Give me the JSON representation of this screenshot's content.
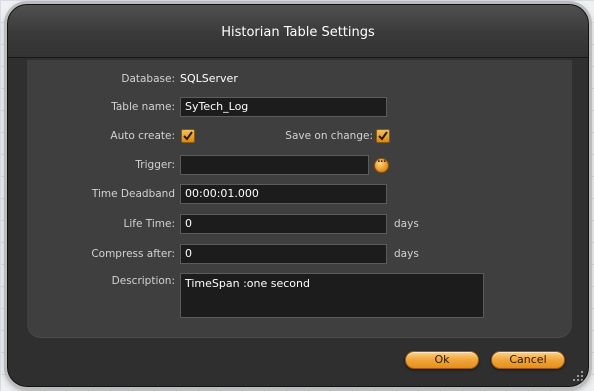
{
  "dialog": {
    "title": "Historian Table Settings",
    "database": {
      "label": "Database:",
      "value": "SQLServer"
    },
    "table_name": {
      "label": "Table name:",
      "value": "SyTech_Log"
    },
    "auto_create": {
      "label": "Auto create:",
      "checked": true
    },
    "save_on_change": {
      "label": "Save on change:",
      "checked": true
    },
    "trigger": {
      "label": "Trigger:",
      "value": "",
      "browse_label": "..."
    },
    "time_deadband": {
      "label": "Time Deadband",
      "value": "00:00:01.000"
    },
    "life_time": {
      "label": "Life Time:",
      "value": "0",
      "units": "days"
    },
    "compress_after": {
      "label": "Compress after:",
      "value": "0",
      "units": "days"
    },
    "description": {
      "label": "Description:",
      "value": "TimeSpan :one second"
    },
    "buttons": {
      "ok": "Ok",
      "cancel": "Cancel"
    }
  },
  "colors": {
    "dialog_bg": "#2f2f30",
    "panel_bg": "#3f3f40",
    "accent_orange": "#f0a43a",
    "field_bg": "#1c1c1c"
  },
  "icons": {
    "checkbox": "checkmark-icon",
    "browse": "ellipsis-browse-icon",
    "resize": "resize-grip-icon"
  }
}
